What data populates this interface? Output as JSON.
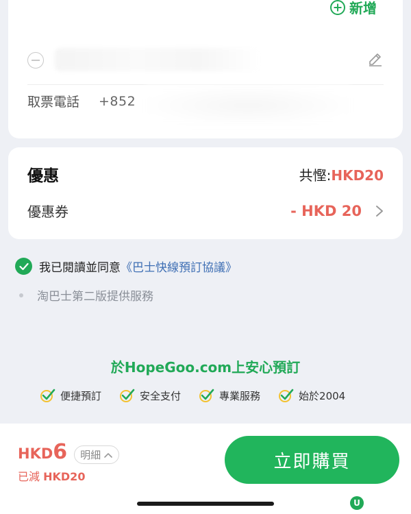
{
  "contact_card": {
    "add_label": "新增",
    "phone_label": "取票電話",
    "phone_code": "+852"
  },
  "discount_card": {
    "title": "優惠",
    "total_label": "共慳:",
    "total_amount": "HKD20",
    "coupon_label": "優惠券",
    "coupon_value": "- HKD 20"
  },
  "agreement": {
    "prefix": "我已閱讀並同意",
    "link": "《巴士快線預訂協議》",
    "service_note": "淘巴士第二版提供服務"
  },
  "promo": {
    "title": "於HopeGoo.com上安心預訂",
    "badges": [
      "便捷預訂",
      "安全支付",
      "專業服務",
      "始於2004"
    ]
  },
  "bottom": {
    "currency": "HKD",
    "price": "6",
    "detail_label": "明細",
    "saved_prefix": "已減",
    "saved_amount": "HKD20",
    "buy_label": "立即購買",
    "watermark": "U"
  },
  "colors": {
    "brand_green": "#21a957",
    "button_green": "#21b55c",
    "discount_red": "#e7645a",
    "link_blue": "#3f6fb4"
  }
}
